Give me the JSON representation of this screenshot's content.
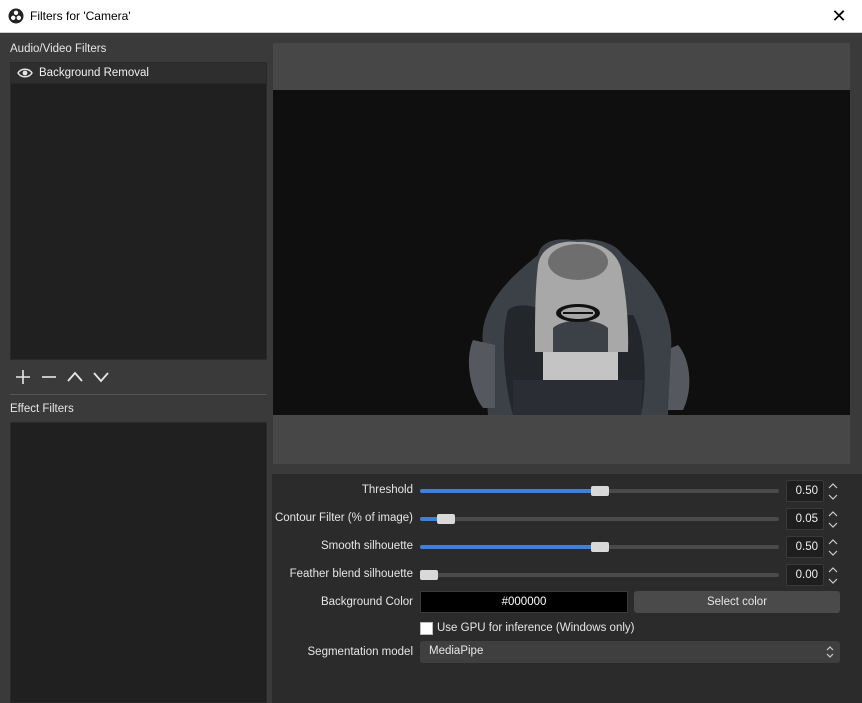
{
  "window": {
    "title": "Filters for 'Camera'",
    "close_glyph": "✕"
  },
  "left": {
    "av_label": "Audio/Video Filters",
    "av_items": [
      {
        "label": "Background Removal",
        "icon": "eye-icon"
      }
    ],
    "effect_label": "Effect Filters",
    "toolbar": [
      "plus-icon",
      "minus-icon",
      "chevron-up-icon",
      "chevron-down-icon"
    ]
  },
  "properties": {
    "threshold": {
      "label": "Threshold",
      "value": "0.50",
      "fraction": 0.5
    },
    "contour": {
      "label": "Contour Filter (% of image)",
      "value": "0.05",
      "fraction": 0.05
    },
    "smooth": {
      "label": "Smooth silhouette",
      "value": "0.50",
      "fraction": 0.5
    },
    "feather": {
      "label": "Feather blend silhouette",
      "value": "0.00",
      "fraction": 0.0
    },
    "bg_color": {
      "label": "Background Color",
      "value": "#000000",
      "button": "Select color"
    },
    "gpu": {
      "label": "Use GPU for inference (Windows only)",
      "checked": false
    },
    "segmentation": {
      "label": "Segmentation model",
      "value": "MediaPipe"
    }
  },
  "colors": {
    "accent": "#3c82d6",
    "panel": "#2b2b2b",
    "background": "#3a3a3a"
  }
}
